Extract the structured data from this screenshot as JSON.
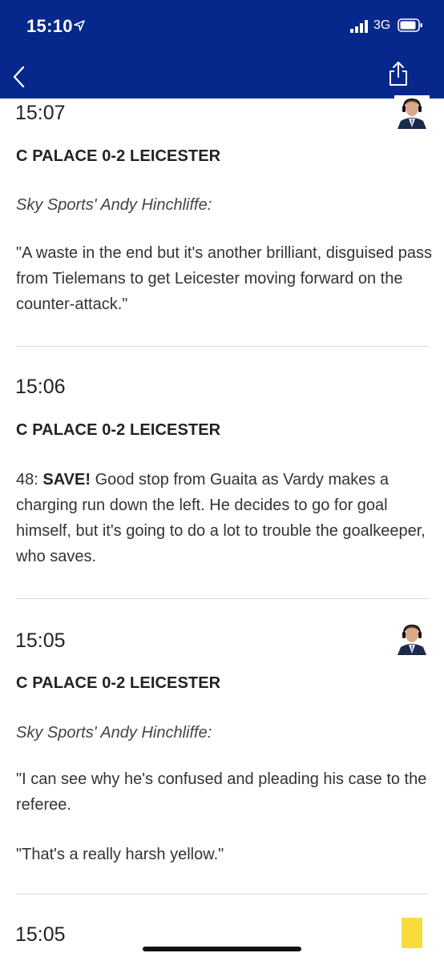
{
  "status_bar": {
    "time": "15:10",
    "network": "3G",
    "signal_icon": "signal-bars-icon",
    "battery_icon": "battery-icon",
    "location_icon": "location-arrow-icon"
  },
  "nav": {
    "back_icon": "chevron-left-icon",
    "share_icon": "share-icon"
  },
  "colors": {
    "header_bg": "#06278c",
    "divider": "#dcdcdc",
    "yellow_card": "#f7dc3c"
  },
  "entries": [
    {
      "time": "15:07",
      "score": "C PALACE 0-2 LEICESTER",
      "byline": "Sky Sports' Andy Hinchliffe:",
      "paragraphs": [
        "\"A waste in the end but it's another brilliant, disguised pass from Tielemans to get Leicester moving forward on the counter-attack.\""
      ],
      "icon": "commentator-avatar-icon"
    },
    {
      "time": "15:06",
      "score": "C PALACE 0-2 LEICESTER",
      "minute": "48:",
      "highlight": "SAVE!",
      "text": "Good stop from Guaita as Vardy makes a charging run down the left. He decides to go for goal himself, but it's going to do a lot to trouble the goalkeeper, who saves."
    },
    {
      "time": "15:05",
      "score": "C PALACE 0-2 LEICESTER",
      "byline": "Sky Sports' Andy Hinchliffe:",
      "paragraphs": [
        "\"I can see why he's confused and pleading his case to the referee.",
        "\"That's a really harsh yellow.\""
      ],
      "icon": "commentator-avatar-icon"
    },
    {
      "time": "15:05",
      "icon": "yellow-card-icon"
    }
  ]
}
